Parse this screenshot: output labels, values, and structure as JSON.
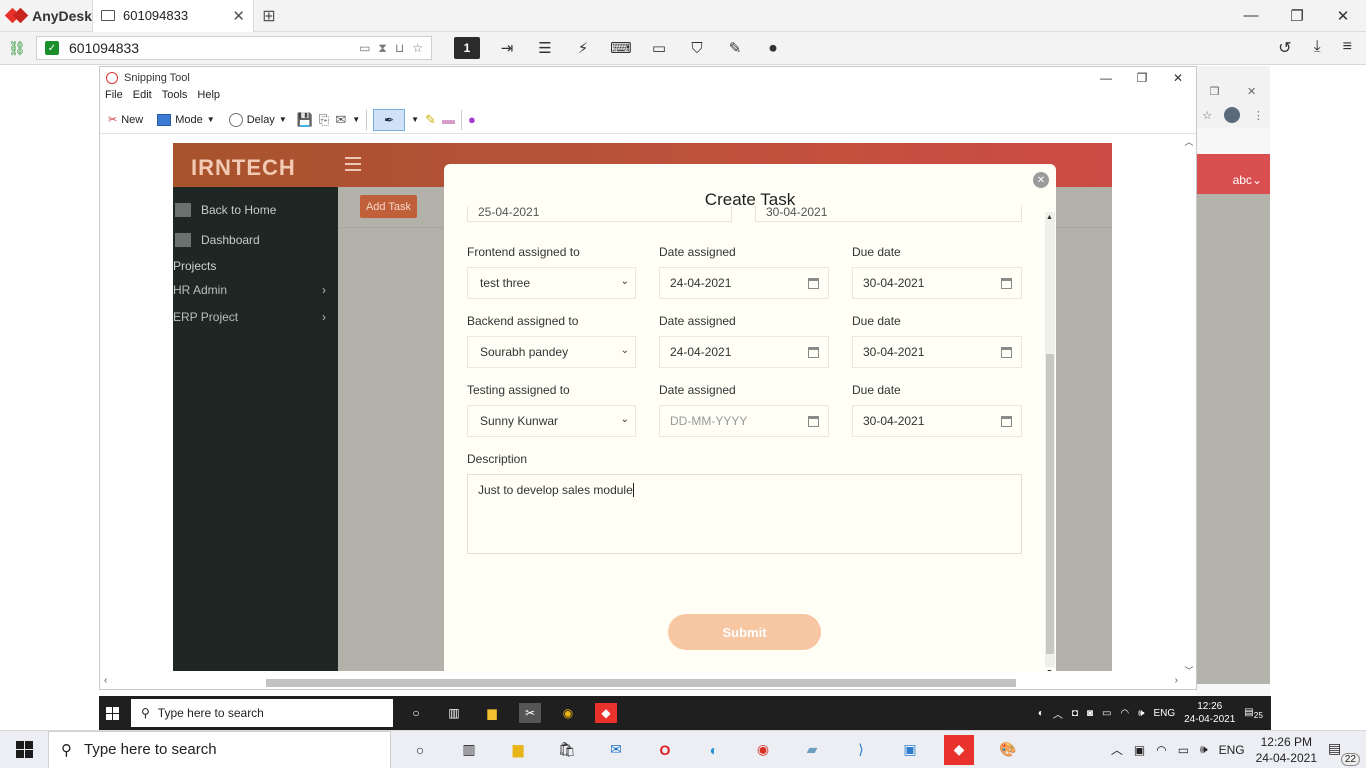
{
  "anydesk": {
    "brand": "AnyDesk",
    "tab_label": "601094833",
    "tab_close": "✕",
    "new_tab": "⊞",
    "address": "601094833",
    "window_controls": [
      "—",
      "❐",
      "✕"
    ],
    "toolbar_monitor": "1",
    "accent_color": "#e8322b"
  },
  "snipping_tool": {
    "title": "Snipping Tool",
    "menu": [
      "File",
      "Edit",
      "Tools",
      "Help"
    ],
    "new_label": "New",
    "mode_label": "Mode",
    "delay_label": "Delay",
    "window_controls": [
      "—",
      "❐",
      "✕"
    ]
  },
  "app": {
    "logo": "IRNTECH",
    "sidebar": {
      "back_home": "Back to Home",
      "dashboard": "Dashboard",
      "projects_heading": "Projects",
      "projects": [
        "HR Admin",
        "ERP Project"
      ]
    },
    "add_task_button": "Add Task",
    "user_menu": "abc",
    "header_color": "#c4503e",
    "sidebar_color": "#1e2723"
  },
  "modal": {
    "title": "Create Task",
    "close_icon": "✕",
    "partial_dates": [
      "25-04-2021",
      "30-04-2021"
    ],
    "rows": [
      {
        "assignee_label": "Frontend assigned to",
        "assignee": "test three",
        "date_label": "Date assigned",
        "date": "24-04-2021",
        "due_label": "Due date",
        "due": "30-04-2021"
      },
      {
        "assignee_label": "Backend assigned to",
        "assignee": "Sourabh pandey",
        "date_label": "Date assigned",
        "date": "24-04-2021",
        "due_label": "Due date",
        "due": "30-04-2021"
      },
      {
        "assignee_label": "Testing assigned to",
        "assignee": "Sunny Kunwar",
        "date_label": "Date assigned",
        "date_placeholder": "DD-MM-YYYY",
        "due_label": "Due date",
        "due": "30-04-2021"
      }
    ],
    "description_label": "Description",
    "description": "Just to develop sales module",
    "submit_label": "Submit",
    "submit_color": "#f7c6a2"
  },
  "remote_taskbar": {
    "search_placeholder": "Type here to search",
    "time": "12:26",
    "date": "24-04-2021",
    "lang": "ENG",
    "notification_count": "25"
  },
  "local_taskbar": {
    "search_placeholder": "Type here to search",
    "time": "12:26 PM",
    "date": "24-04-2021",
    "lang": "ENG",
    "notification_count": "22"
  }
}
